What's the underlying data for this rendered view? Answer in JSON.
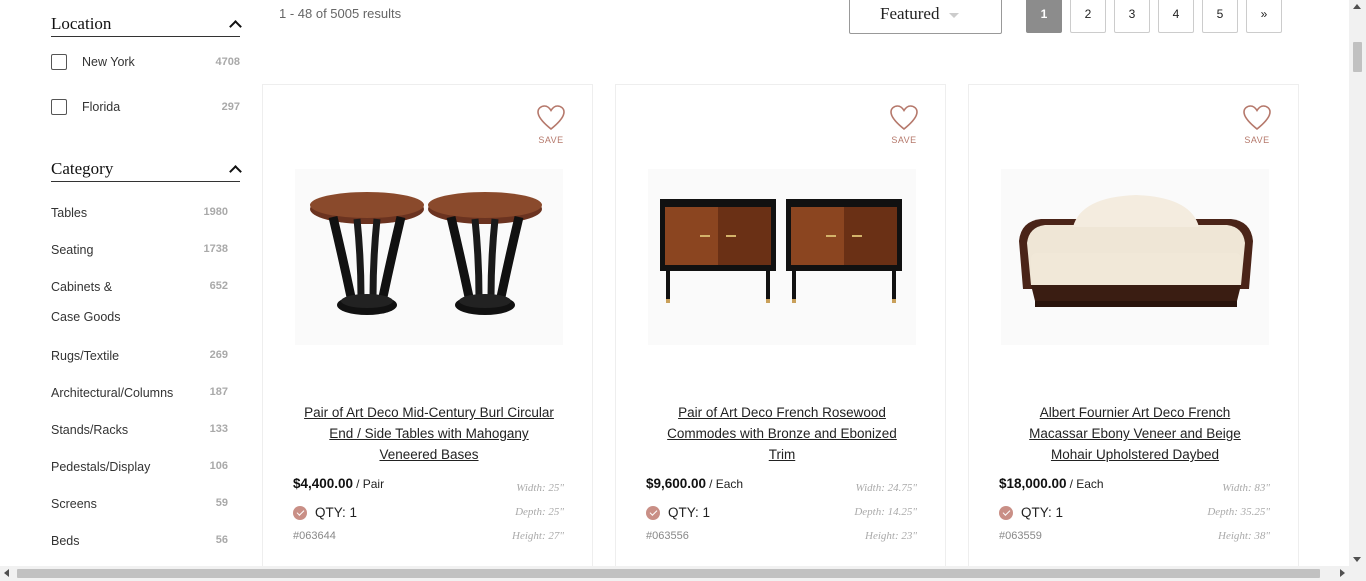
{
  "sidebar": {
    "location": {
      "title": "Location",
      "items": [
        {
          "label": "New York",
          "count": "4708"
        },
        {
          "label": "Florida",
          "count": "297"
        }
      ]
    },
    "category": {
      "title": "Category",
      "items": [
        {
          "label": "Tables",
          "count": "1980"
        },
        {
          "label": "Seating",
          "count": "1738"
        },
        {
          "label": "Cabinets &",
          "label2": "Case Goods",
          "count": "652"
        },
        {
          "label": "Rugs/Textile",
          "count": "269"
        },
        {
          "label": "Architectural/Columns",
          "count": "187"
        },
        {
          "label": "Stands/Racks",
          "count": "133"
        },
        {
          "label": "Pedestals/Display",
          "count": "106"
        },
        {
          "label": "Screens",
          "count": "59"
        },
        {
          "label": "Beds",
          "count": "56"
        }
      ]
    }
  },
  "toolbar": {
    "results_text": "1 - 48 of 5005 results",
    "sort_label": "Featured",
    "pages": [
      "1",
      "2",
      "3",
      "4",
      "5",
      "»"
    ],
    "active_page": "1"
  },
  "products": [
    {
      "save_label": "SAVE",
      "image_icon": "round-end-tables-pair",
      "title": "Pair of Art Deco Mid-Century Burl Circular End / Side Tables with Mahogany Veneered Bases",
      "price": "$4,400.00",
      "unit": "/ Pair",
      "qty": "QTY: 1",
      "sku": "#063644",
      "width": "Width: 25\"",
      "depth": "Depth: 25\"",
      "height": "Height: 27\""
    },
    {
      "save_label": "SAVE",
      "image_icon": "commodes-pair",
      "title": "Pair of Art Deco French Rosewood Commodes with Bronze and Ebonized Trim",
      "price": "$9,600.00",
      "unit": "/ Each",
      "qty": "QTY: 1",
      "sku": "#063556",
      "width": "Width: 24.75\"",
      "depth": "Depth: 14.25\"",
      "height": "Height: 23\""
    },
    {
      "save_label": "SAVE",
      "image_icon": "daybed",
      "title": "Albert Fournier Art Deco French Macassar Ebony Veneer and Beige Mohair Upholstered Daybed",
      "price": "$18,000.00",
      "unit": "/ Each",
      "qty": "QTY: 1",
      "sku": "#063559",
      "width": "Width: 83\"",
      "depth": "Depth: 35.25\"",
      "height": "Height: 38\""
    }
  ],
  "colors": {
    "accent": "#b5786b",
    "active_page_bg": "#8c8c8c",
    "check_circle": "#c98f86"
  }
}
